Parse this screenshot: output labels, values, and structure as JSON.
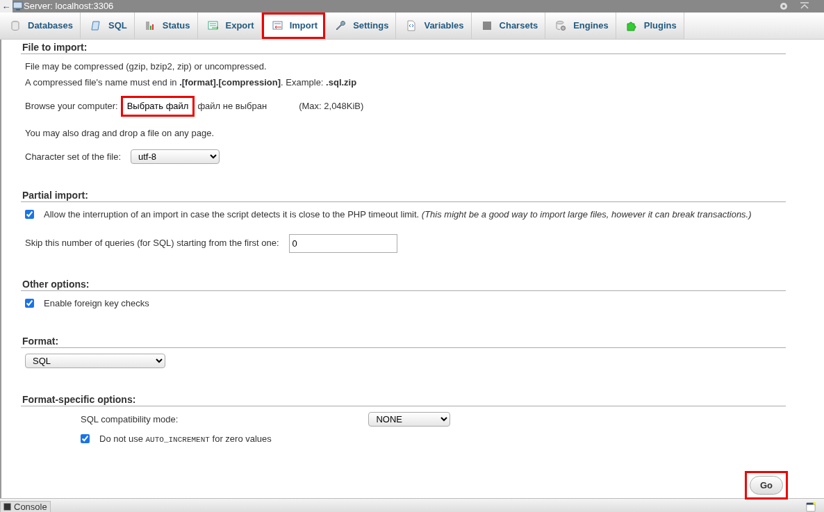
{
  "top_bar": {
    "back": "←",
    "title": "Server: localhost:3306"
  },
  "tabs": [
    {
      "label": "Databases",
      "selected": false,
      "highlighted": false
    },
    {
      "label": "SQL",
      "selected": false,
      "highlighted": false
    },
    {
      "label": "Status",
      "selected": false,
      "highlighted": false
    },
    {
      "label": "Export",
      "selected": false,
      "highlighted": false
    },
    {
      "label": "Import",
      "selected": true,
      "highlighted": true
    },
    {
      "label": "Settings",
      "selected": false,
      "highlighted": false
    },
    {
      "label": "Variables",
      "selected": false,
      "highlighted": false
    },
    {
      "label": "Charsets",
      "selected": false,
      "highlighted": false
    },
    {
      "label": "Engines",
      "selected": false,
      "highlighted": false
    },
    {
      "label": "Plugins",
      "selected": false,
      "highlighted": false
    }
  ],
  "sections": [
    {
      "title": "File to import:",
      "items": [
        {
          "kind": "text",
          "text": "File may be compressed (gzip, bzip2, zip) or uncompressed."
        },
        {
          "kind": "text",
          "text": "A compressed file's name must end in **.[format].[compression]**. Example: **.sql.zip**"
        },
        {
          "kind": "file",
          "label": "Browse your computer:",
          "button": "Выбрать файл",
          "status": "файл не выбран",
          "max": "(Max: 2,048KiB)",
          "highlighted": true
        },
        {
          "kind": "text",
          "text": "You may also drag and drop a file on any page."
        },
        {
          "kind": "select",
          "label": "Character set of the file:",
          "value": "utf-8"
        }
      ]
    },
    {
      "title": "Partial import:",
      "items": [
        {
          "kind": "checkbox",
          "checked": true,
          "text": "Allow the interruption of an import in case the script detects it is close to the PHP timeout limit. *(This might be a good way to import large files, however it can break transactions.)*"
        },
        {
          "kind": "number",
          "label": "Skip this number of queries (for SQL) starting from the first one:",
          "value": "0"
        }
      ]
    },
    {
      "title": "Other options:",
      "items": [
        {
          "kind": "checkbox",
          "checked": true,
          "text": "Enable foreign key checks"
        }
      ]
    },
    {
      "title": "Format:",
      "items": [
        {
          "kind": "select",
          "value": "SQL"
        }
      ]
    },
    {
      "title": "Format-specific options:",
      "indented": true,
      "items": [
        {
          "kind": "select",
          "label": "SQL compatibility mode:",
          "value": "NONE"
        },
        {
          "kind": "checkbox",
          "checked": true,
          "text": "Do not use ",
          "code": "AUTO_INCREMENT",
          "text_after": " for zero values"
        }
      ]
    }
  ],
  "go_button": {
    "label": "Go",
    "highlighted": true
  },
  "console": {
    "label": "Console"
  }
}
